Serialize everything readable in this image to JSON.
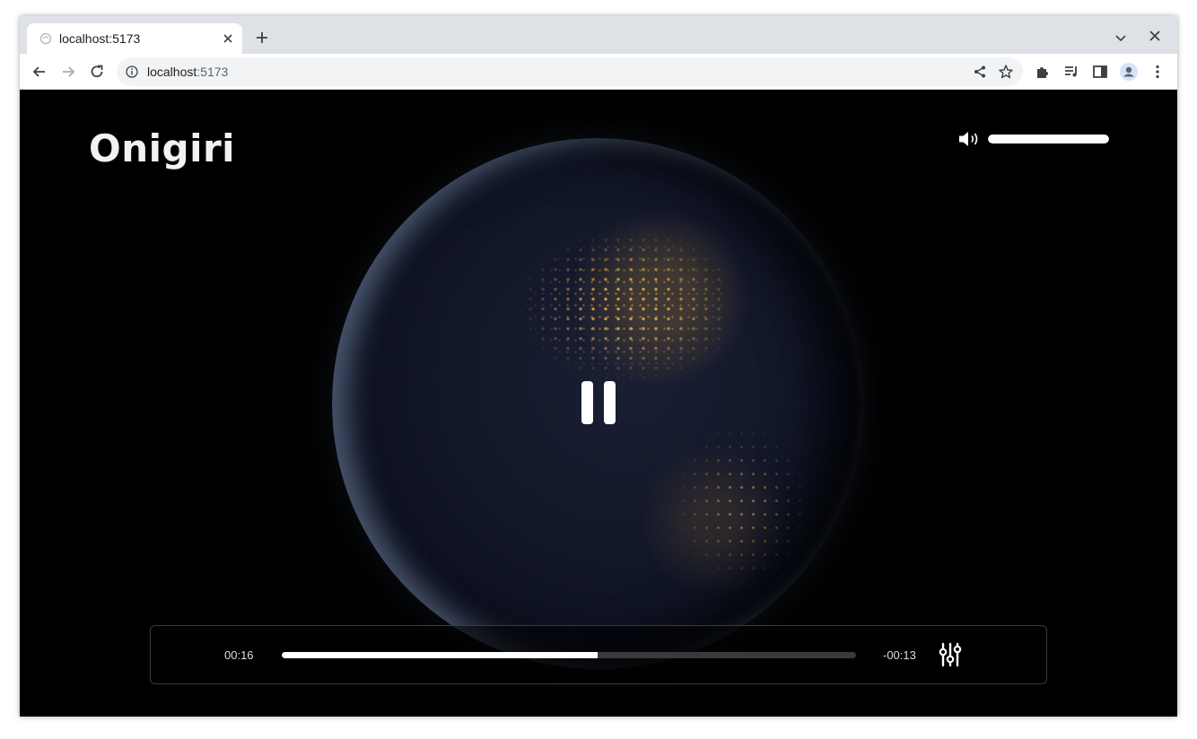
{
  "browser": {
    "tab_title": "localhost:5173",
    "url_host": "localhost",
    "url_port": ":5173"
  },
  "app": {
    "title": "Onigiri"
  },
  "player": {
    "state": "playing",
    "elapsed": "00:16",
    "remaining": "-00:13",
    "progress_fraction": 0.55,
    "volume_fraction": 1.0
  },
  "icons": {
    "tab_favicon": "spinner-favicon-icon",
    "volume": "speaker-icon",
    "pause": "pause-icon",
    "settings": "equalizer-sliders-icon"
  },
  "colors": {
    "background": "#000000",
    "accent": "#ffffff",
    "track": "#3a3a3a",
    "panel_border": "#3c3c3c"
  }
}
